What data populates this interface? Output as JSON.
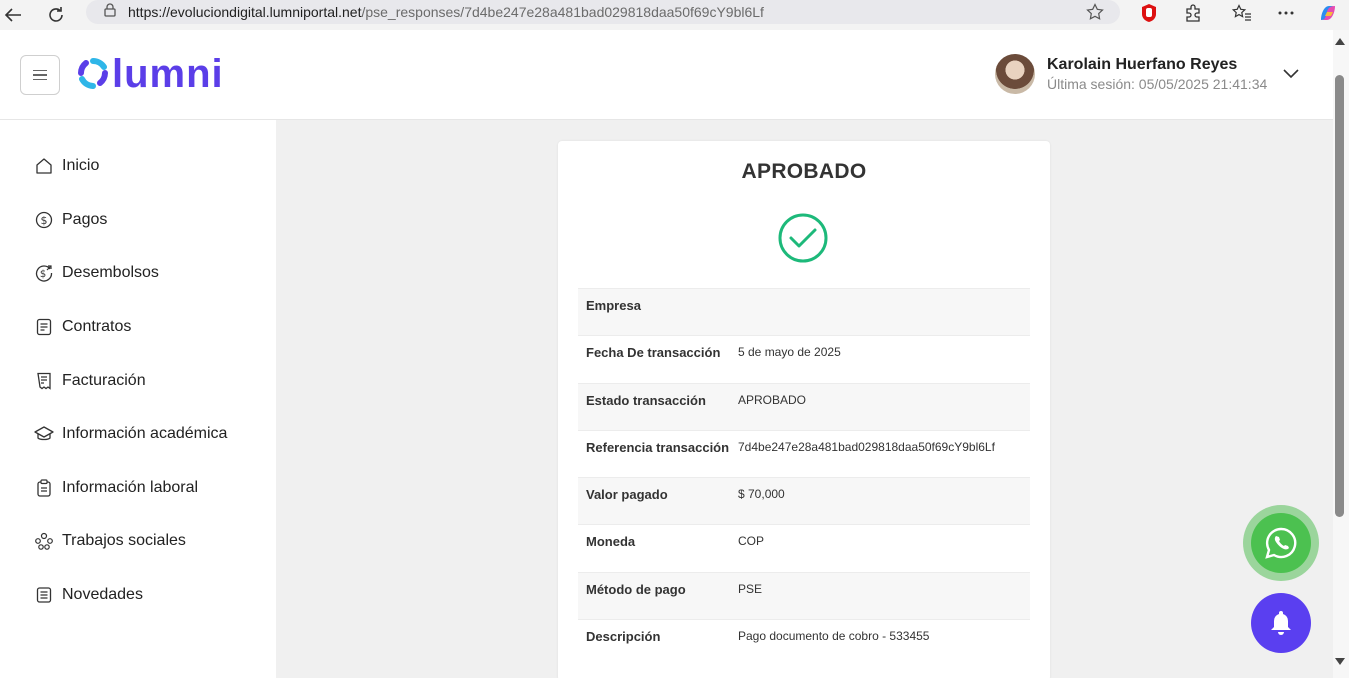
{
  "browser": {
    "url_host": "https://evoluciondigital.lumniportal.net",
    "url_path": "/pse_responses/7d4be247e28a481bad029818daa50f69cY9bl6Lf"
  },
  "header": {
    "logo_text": "lumni",
    "user_name": "Karolain Huerfano Reyes",
    "last_session": "Última sesión: 05/05/2025 21:41:34"
  },
  "sidebar": {
    "items": [
      {
        "label": "Inicio",
        "icon": "home-icon"
      },
      {
        "label": "Pagos",
        "icon": "dollar-icon"
      },
      {
        "label": "Desembolsos",
        "icon": "disbursement-icon"
      },
      {
        "label": "Contratos",
        "icon": "contract-icon"
      },
      {
        "label": "Facturación",
        "icon": "invoice-icon"
      },
      {
        "label": "Información académica",
        "icon": "graduation-cap-icon"
      },
      {
        "label": "Información laboral",
        "icon": "clipboard-icon"
      },
      {
        "label": "Trabajos sociales",
        "icon": "people-icon"
      },
      {
        "label": "Novedades",
        "icon": "news-icon"
      }
    ]
  },
  "result": {
    "status_title": "APROBADO",
    "rows": [
      {
        "label": "Empresa",
        "value": ""
      },
      {
        "label": "Fecha De transacción",
        "value": "5 de mayo de 2025"
      },
      {
        "label": "Estado transacción",
        "value": "APROBADO"
      },
      {
        "label": "Referencia transacción",
        "value": "7d4be247e28a481bad029818daa50f69cY9bl6Lf"
      },
      {
        "label": "Valor pagado",
        "value": "$ 70,000"
      },
      {
        "label": "Moneda",
        "value": "COP"
      },
      {
        "label": "Método de pago",
        "value": "PSE"
      },
      {
        "label": "Descripción",
        "value": "Pago documento de cobro - 533455"
      }
    ]
  },
  "colors": {
    "brand_purple": "#5b3ee8",
    "brand_cyan": "#2fb6e8",
    "success_green": "#1db97a",
    "whatsapp_green": "#4cc150",
    "bell_purple": "#5a3ff0"
  }
}
